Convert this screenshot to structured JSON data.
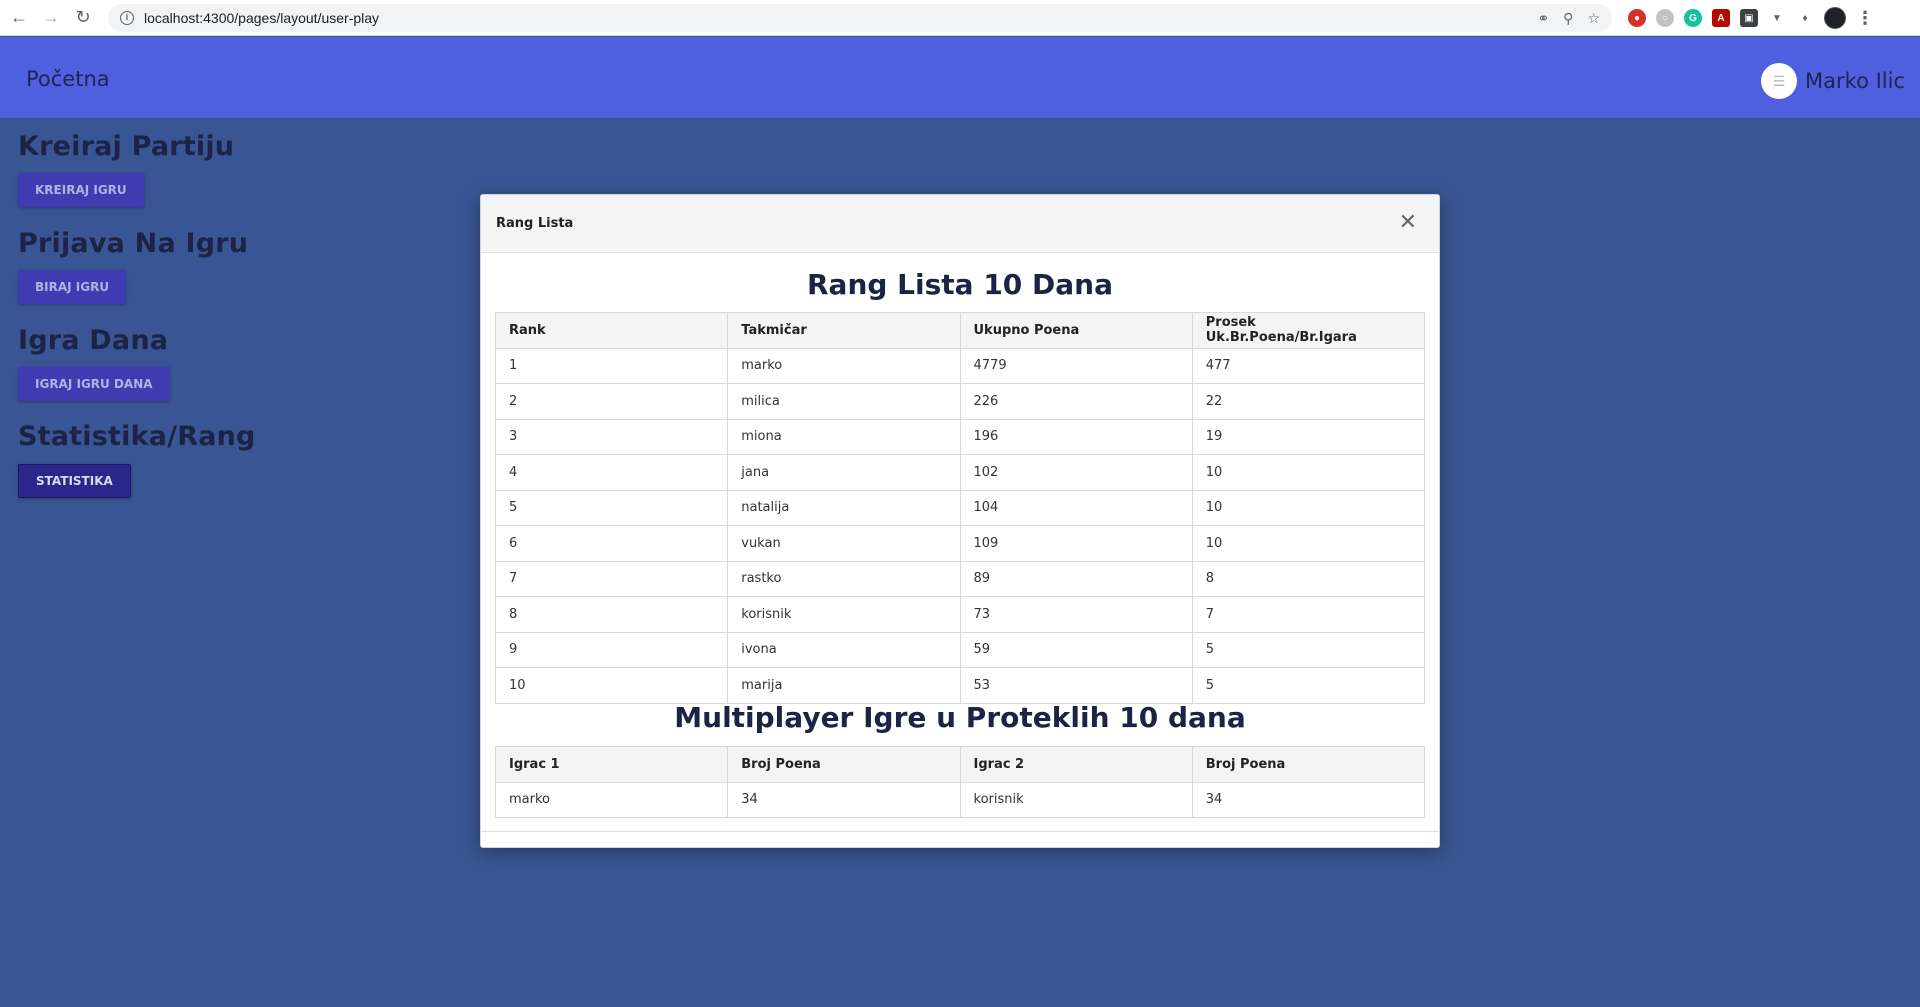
{
  "browser": {
    "url": "localhost:4300/pages/layout/user-play"
  },
  "header": {
    "home_label": "Početna",
    "user_name": "Marko Ilic"
  },
  "sidebar": {
    "sections": [
      {
        "title": "Kreiraj Partiju",
        "button": "KREIRAJ IGRU"
      },
      {
        "title": "Prijava Na Igru",
        "button": "BIRAJ IGRU"
      },
      {
        "title": "Igra Dana",
        "button": "IGRAJ IGRU DANA"
      },
      {
        "title": "Statistika/Rang",
        "button": "STATISTIKA"
      }
    ]
  },
  "modal": {
    "title": "Rang Lista",
    "close_icon": "close-icon",
    "rank_heading": "Rang Lista 10 Dana",
    "rank_columns": [
      "Rank",
      "Takmičar",
      "Ukupno Poena",
      "Prosek Uk.Br.Poena/Br.Igara"
    ],
    "rank_rows": [
      [
        "1",
        "marko",
        "4779",
        "477"
      ],
      [
        "2",
        "milica",
        "226",
        "22"
      ],
      [
        "3",
        "miona",
        "196",
        "19"
      ],
      [
        "4",
        "jana",
        "102",
        "10"
      ],
      [
        "5",
        "natalija",
        "104",
        "10"
      ],
      [
        "6",
        "vukan",
        "109",
        "10"
      ],
      [
        "7",
        "rastko",
        "89",
        "8"
      ],
      [
        "8",
        "korisnik",
        "73",
        "7"
      ],
      [
        "9",
        "ivona",
        "59",
        "5"
      ],
      [
        "10",
        "marija",
        "53",
        "5"
      ]
    ],
    "multi_heading": "Multiplayer Igre u Proteklih 10 dana",
    "multi_columns": [
      "Igrac 1",
      "Broj Poena",
      "Igrac 2",
      "Broj Poena"
    ],
    "multi_rows": [
      [
        "marko",
        "34",
        "korisnik",
        "34"
      ]
    ]
  },
  "colors": {
    "page_bg": "#3a5593",
    "appbar": "#4e5fe0",
    "button": "#3f3bb0"
  }
}
